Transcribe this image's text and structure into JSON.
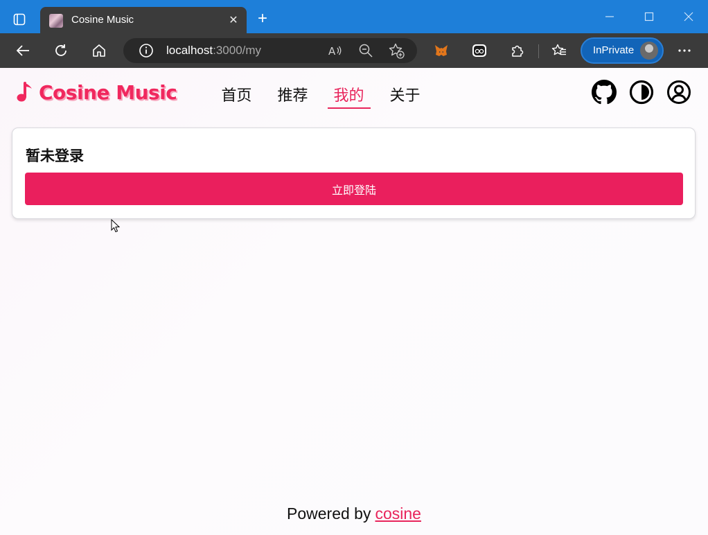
{
  "browser": {
    "tab_title": "Cosine Music",
    "address_host": "localhost",
    "address_path": ":3000/my",
    "inprivate_label": "InPrivate",
    "icons": [
      "tab-actions-icon",
      "favicon",
      "close-icon",
      "new-tab-icon",
      "minimize-icon",
      "maximize-icon",
      "window-close-icon",
      "back-icon",
      "refresh-icon",
      "home-icon",
      "info-icon",
      "read-aloud-icon",
      "zoom-icon",
      "favorite-add-icon",
      "metamask-icon",
      "extension-icon",
      "extensions-icon",
      "favorites-icon",
      "more-icon"
    ]
  },
  "header": {
    "logo_text": "Cosine Music",
    "nav": [
      {
        "label": "首页",
        "active": false
      },
      {
        "label": "推荐",
        "active": false
      },
      {
        "label": "我的",
        "active": true
      },
      {
        "label": "关于",
        "active": false
      }
    ],
    "icons": [
      "github-icon",
      "theme-toggle-icon",
      "user-icon"
    ]
  },
  "login_card": {
    "title": "暂未登录",
    "button_label": "立即登陆"
  },
  "footer": {
    "prefix": "Powered by",
    "link_text": "cosine"
  },
  "colors": {
    "accent": "#ea1f5d",
    "titlebar": "#1e7fd9",
    "toolbar": "#3b3b3b"
  }
}
